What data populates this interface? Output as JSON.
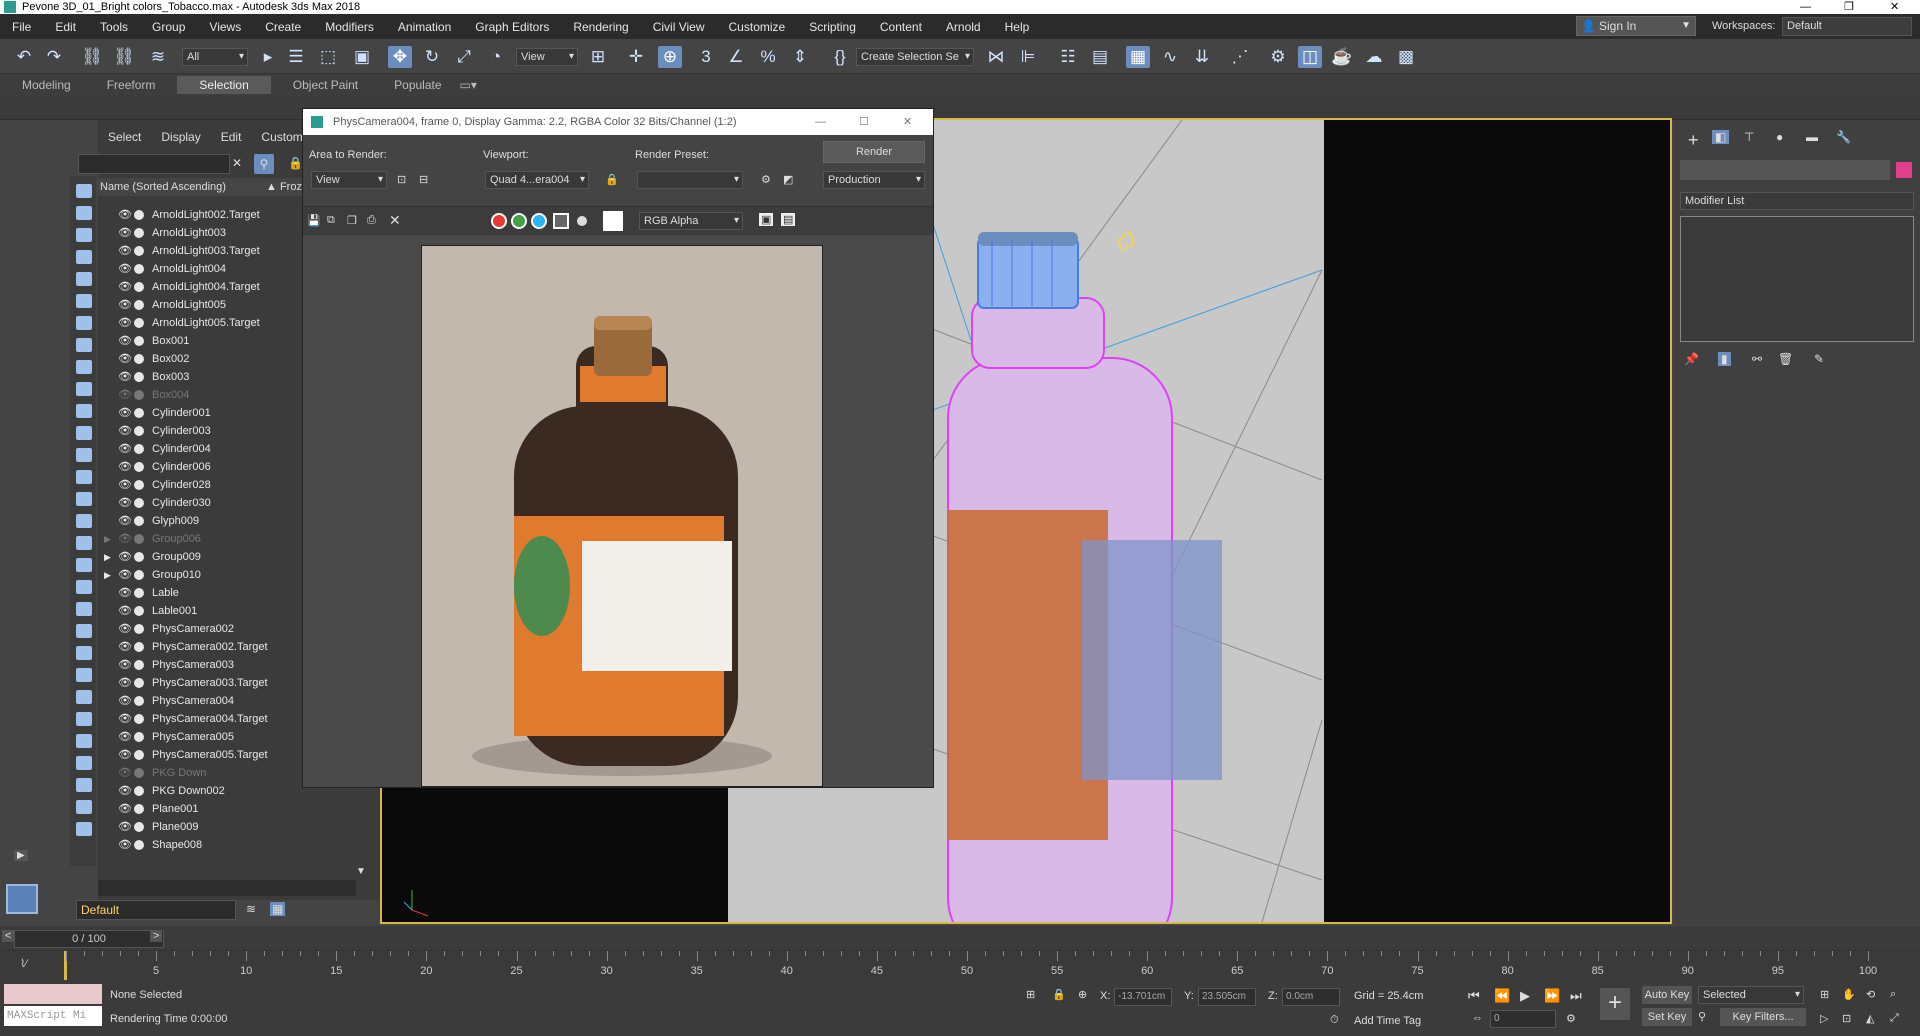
{
  "window": {
    "title": "Pevone 3D_01_Bright colors_Tobacco.max - Autodesk 3ds Max 2018"
  },
  "menu": [
    "File",
    "Edit",
    "Tools",
    "Group",
    "Views",
    "Create",
    "Modifiers",
    "Animation",
    "Graph Editors",
    "Rendering",
    "Civil View",
    "Customize",
    "Scripting",
    "Content",
    "Arnold",
    "Help"
  ],
  "account": {
    "signin": "Sign In",
    "workspaces_label": "Workspaces:",
    "workspace": "Default"
  },
  "toolbar": {
    "filter": "All",
    "view_combo": "View",
    "selection_set": "Create Selection Se"
  },
  "ribbon": {
    "tabs": [
      "Modeling",
      "Freeform",
      "Selection",
      "Object Paint",
      "Populate"
    ]
  },
  "explorer": {
    "menu": [
      "Select",
      "Display",
      "Edit",
      "Customize"
    ],
    "header": "Name (Sorted Ascending)",
    "header2": "▲ Froz",
    "rows": [
      {
        "name": "ArnoldLight002.Target",
        "dim": false,
        "arrow": ""
      },
      {
        "name": "ArnoldLight003",
        "dim": false,
        "arrow": ""
      },
      {
        "name": "ArnoldLight003.Target",
        "dim": false,
        "arrow": ""
      },
      {
        "name": "ArnoldLight004",
        "dim": false,
        "arrow": ""
      },
      {
        "name": "ArnoldLight004.Target",
        "dim": false,
        "arrow": ""
      },
      {
        "name": "ArnoldLight005",
        "dim": false,
        "arrow": ""
      },
      {
        "name": "ArnoldLight005.Target",
        "dim": false,
        "arrow": ""
      },
      {
        "name": "Box001",
        "dim": false,
        "arrow": ""
      },
      {
        "name": "Box002",
        "dim": false,
        "arrow": ""
      },
      {
        "name": "Box003",
        "dim": false,
        "arrow": ""
      },
      {
        "name": "Box004",
        "dim": true,
        "arrow": ""
      },
      {
        "name": "Cylinder001",
        "dim": false,
        "arrow": ""
      },
      {
        "name": "Cylinder003",
        "dim": false,
        "arrow": ""
      },
      {
        "name": "Cylinder004",
        "dim": false,
        "arrow": ""
      },
      {
        "name": "Cylinder006",
        "dim": false,
        "arrow": ""
      },
      {
        "name": "Cylinder028",
        "dim": false,
        "arrow": ""
      },
      {
        "name": "Cylinder030",
        "dim": false,
        "arrow": ""
      },
      {
        "name": "Glyph009",
        "dim": false,
        "arrow": ""
      },
      {
        "name": "Group006",
        "dim": true,
        "arrow": "▶"
      },
      {
        "name": "Group009",
        "dim": false,
        "arrow": "▶"
      },
      {
        "name": "Group010",
        "dim": false,
        "arrow": "▶"
      },
      {
        "name": "Lable",
        "dim": false,
        "arrow": ""
      },
      {
        "name": "Lable001",
        "dim": false,
        "arrow": ""
      },
      {
        "name": "PhysCamera002",
        "dim": false,
        "arrow": ""
      },
      {
        "name": "PhysCamera002.Target",
        "dim": false,
        "arrow": ""
      },
      {
        "name": "PhysCamera003",
        "dim": false,
        "arrow": ""
      },
      {
        "name": "PhysCamera003.Target",
        "dim": false,
        "arrow": ""
      },
      {
        "name": "PhysCamera004",
        "dim": false,
        "arrow": ""
      },
      {
        "name": "PhysCamera004.Target",
        "dim": false,
        "arrow": ""
      },
      {
        "name": "PhysCamera005",
        "dim": false,
        "arrow": ""
      },
      {
        "name": "PhysCamera005.Target",
        "dim": false,
        "arrow": ""
      },
      {
        "name": "PKG Down",
        "dim": true,
        "arrow": ""
      },
      {
        "name": "PKG Down002",
        "dim": false,
        "arrow": ""
      },
      {
        "name": "Plane001",
        "dim": false,
        "arrow": ""
      },
      {
        "name": "Plane009",
        "dim": false,
        "arrow": ""
      },
      {
        "name": "Shape008",
        "dim": false,
        "arrow": ""
      }
    ]
  },
  "layer": "Default",
  "render": {
    "title": "PhysCamera004, frame 0, Display Gamma: 2.2, RGBA Color 32 Bits/Channel (1:2)",
    "area_label": "Area to Render:",
    "area": "View",
    "viewport_label": "Viewport:",
    "viewport": "Quad 4...era004",
    "preset_label": "Render Preset:",
    "preset": "",
    "render_btn": "Render",
    "production": "Production",
    "channel": "RGB Alpha"
  },
  "cmdpanel": {
    "modifier_list": "Modifier List"
  },
  "timeline": {
    "slider": "0 / 100",
    "ticks": [
      "5",
      "10",
      "15",
      "20",
      "25",
      "30",
      "35",
      "40",
      "45",
      "50",
      "55",
      "60",
      "65",
      "70",
      "75",
      "80",
      "85",
      "90",
      "95",
      "100"
    ]
  },
  "status": {
    "selection": "None Selected",
    "render_time": "Rendering Time  0:00:00",
    "maxscript": "MAXScript Mi",
    "x_label": "X:",
    "x": "-13.701cm",
    "y_label": "Y:",
    "y": "23.505cm",
    "z_label": "Z:",
    "z": "0.0cm",
    "grid": "Grid = 25.4cm",
    "add_time_tag": "Add Time Tag",
    "auto_key": "Auto Key",
    "selected": "Selected",
    "set_key": "Set Key",
    "key_filters": "Key Filters...",
    "frame": "0"
  },
  "colors": {
    "accent": "#6c8ebf",
    "viewport_border": "#d9b84a",
    "wire_pink": "#e040fb",
    "wire_blue": "#4a7be0"
  }
}
